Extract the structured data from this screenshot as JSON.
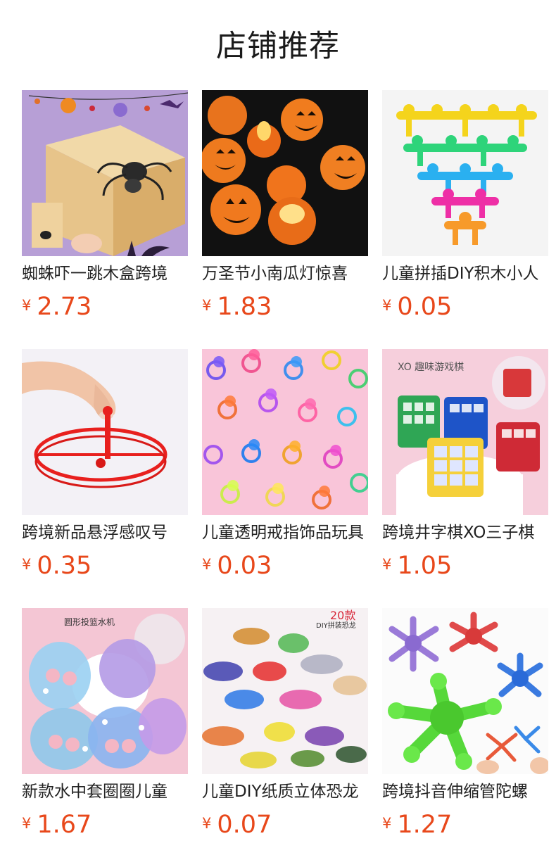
{
  "header": {
    "title": "店铺推荐"
  },
  "currency_symbol": "¥",
  "colors": {
    "price": "#e8481b",
    "text": "#222222"
  },
  "products": [
    {
      "name": "蜘蛛吓一跳木盒跨境",
      "price": "2.73",
      "image": "wooden-spider-box"
    },
    {
      "name": "万圣节小南瓜灯惊喜",
      "price": "1.83",
      "image": "pumpkin-lanterns"
    },
    {
      "name": "儿童拼插DIY积木小人",
      "price": "0.05",
      "image": "stacking-figures"
    },
    {
      "name": "跨境新品悬浮感叹号",
      "price": "0.35",
      "image": "red-spinning-top"
    },
    {
      "name": "儿童透明戒指饰品玩具",
      "price": "0.03",
      "image": "jelly-rings"
    },
    {
      "name": "跨境井字棋XO三子棋",
      "price": "1.05",
      "image": "tic-tac-toe-keychains"
    },
    {
      "name": "新款水中套圈圈儿童",
      "price": "1.67",
      "image": "water-ring-games",
      "image_text": "圆形投篮水机"
    },
    {
      "name": "儿童DIY纸质立体恐龙",
      "price": "0.07",
      "image": "paper-dinosaurs",
      "image_text": [
        "20款",
        "DIY拼装恐龙"
      ]
    },
    {
      "name": "跨境抖音伸缩管陀螺",
      "price": "1.27",
      "image": "pop-tube-spinners"
    }
  ]
}
